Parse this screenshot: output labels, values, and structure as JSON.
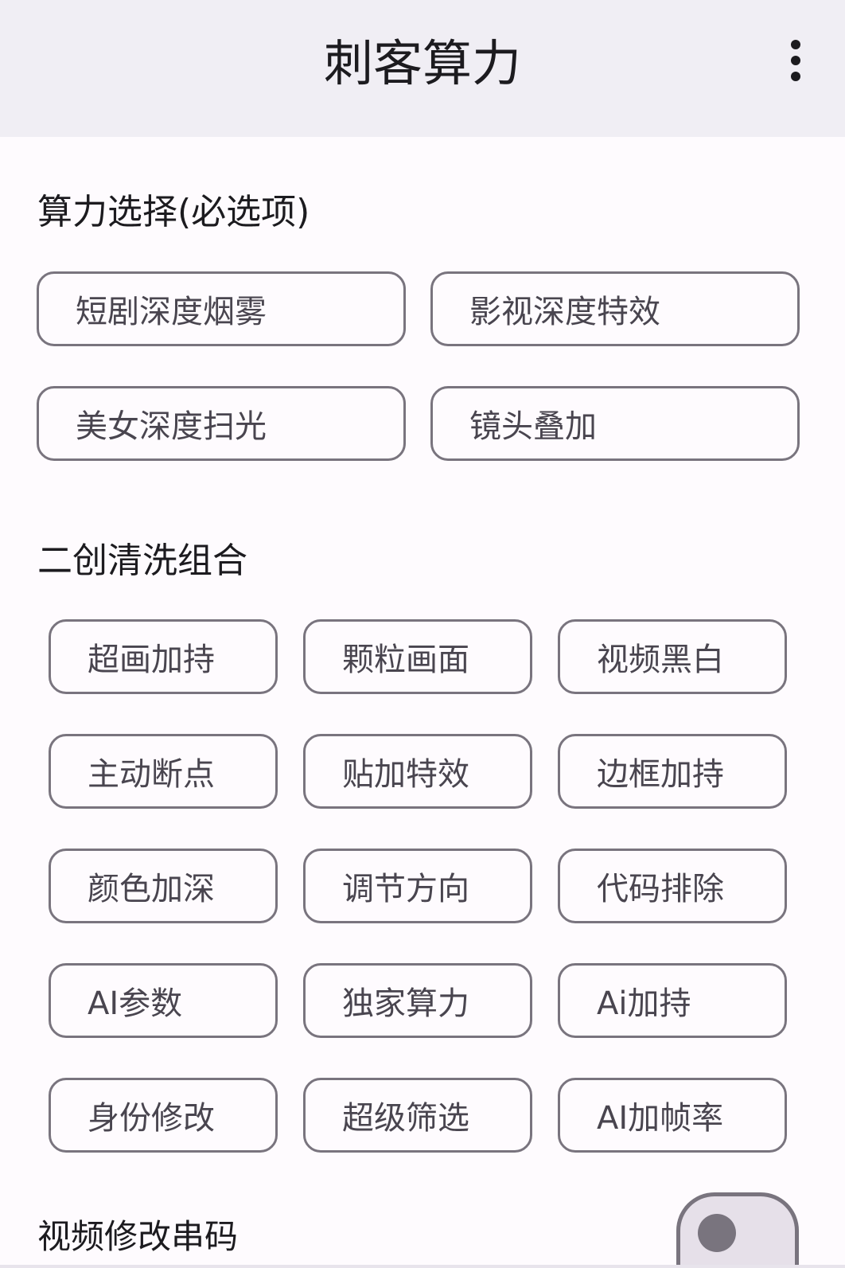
{
  "app_bar": {
    "title": "刺客算力",
    "more_icon": "more-vert-icon"
  },
  "compute_section": {
    "title": "算力选择(必选项)",
    "options": [
      "短剧深度烟雾",
      "影视深度特效",
      "美女深度扫光",
      "镜头叠加"
    ]
  },
  "remix_section": {
    "title": "二创清洗组合",
    "options": [
      "超画加持",
      "颗粒画面",
      "视频黑白",
      "主动断点",
      "贴加特效",
      "边框加持",
      "颜色加深",
      "调节方向",
      "代码排除",
      "AI参数",
      "独家算力",
      "Ai加持",
      "身份修改",
      "超级筛选",
      "AI加帧率"
    ]
  },
  "video_serial": {
    "label": "视频修改串码",
    "enabled": false
  },
  "colors": {
    "app_bar_bg": "#F0EEF4",
    "background": "#FEFBFE",
    "chip_border": "#79747E",
    "chip_text": "#49454F",
    "toggle_track": "#E6E0E9"
  }
}
